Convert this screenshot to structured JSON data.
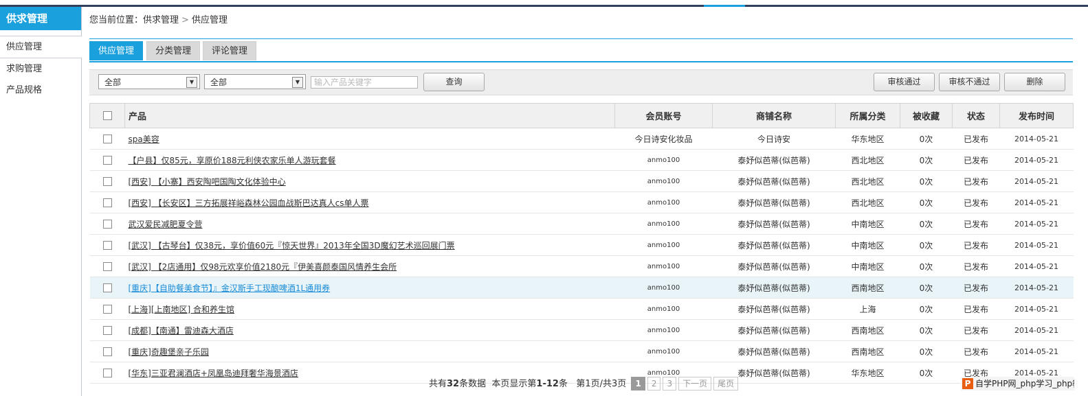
{
  "sidebar": {
    "title": "供求管理",
    "items": [
      "供应管理",
      "求购管理",
      "产品规格"
    ]
  },
  "breadcrumb": {
    "prefix": "您当前位置：",
    "level1": "供求管理",
    "separator": ">",
    "level2": "供应管理"
  },
  "tabs": [
    "供应管理",
    "分类管理",
    "评论管理"
  ],
  "filter": {
    "select1": "全部",
    "select2": "全部",
    "keyword_placeholder": "输入产品关键字",
    "query_button": "查询",
    "approve_button": "审核通过",
    "reject_button": "审核不通过",
    "delete_button": "删除"
  },
  "table": {
    "headers": [
      "产品",
      "会员账号",
      "商铺名称",
      "所属分类",
      "被收藏",
      "状态",
      "发布时间"
    ],
    "rows": [
      [
        "spa美容",
        "今日诗安化妆品",
        "今日诗安",
        "华东地区",
        "0次",
        "已发布",
        "2014-05-21"
      ],
      [
        "【户县】仅85元，享原价188元利侠农家乐单人游玩套餐",
        "anmo100",
        "泰妤似芭蒂(似芭蒂)",
        "西北地区",
        "0次",
        "已发布",
        "2014-05-21"
      ],
      [
        "[西安] 【小寨】西安陶吧国陶文化体验中心",
        "anmo100",
        "泰妤似芭蒂(似芭蒂)",
        "西北地区",
        "0次",
        "已发布",
        "2014-05-21"
      ],
      [
        "[西安] 【长安区】三方拓展祥峪森林公园血战斯巴达真人cs单人票",
        "anmo100",
        "泰妤似芭蒂(似芭蒂)",
        "西北地区",
        "0次",
        "已发布",
        "2014-05-21"
      ],
      [
        "武汉爱民减肥夏令营",
        "anmo100",
        "泰妤似芭蒂(似芭蒂)",
        "中南地区",
        "0次",
        "已发布",
        "2014-05-21"
      ],
      [
        "[武汉] 【古琴台】仅38元，享价值60元『惊天世界』2013年全国3D魔幻艺术巡回展门票",
        "anmo100",
        "泰妤似芭蒂(似芭蒂)",
        "中南地区",
        "0次",
        "已发布",
        "2014-05-21"
      ],
      [
        "[武汉] 【2店通用】仅98元欢享价值2180元『伊美喜颜泰国风情养生会所",
        "anmo100",
        "泰妤似芭蒂(似芭蒂)",
        "中南地区",
        "0次",
        "已发布",
        "2014-05-21"
      ],
      [
        "[重庆]【自助餐美食节】』金汉斯手工现酿啤酒1L通用券",
        "anmo100",
        "泰妤似芭蒂(似芭蒂)",
        "西南地区",
        "0次",
        "已发布",
        "2014-05-21"
      ],
      [
        "[上海][上南地区] 合和养生馆",
        "anmo100",
        "泰妤似芭蒂(似芭蒂)",
        "上海",
        "0次",
        "已发布",
        "2014-05-21"
      ],
      [
        "[成都]【南通】雷迪森大酒店",
        "anmo100",
        "泰妤似芭蒂(似芭蒂)",
        "西南地区",
        "0次",
        "已发布",
        "2014-05-21"
      ],
      [
        "[重庆]奇趣堡亲子乐园",
        "anmo100",
        "泰妤似芭蒂(似芭蒂)",
        "西南地区",
        "0次",
        "已发布",
        "2014-05-21"
      ],
      [
        "[华东]三亚君澜酒店+凤凰岛迪拜奢华海景酒店",
        "anmo100",
        "泰妤似芭蒂(似芭蒂)",
        "华东地区",
        "0次",
        "已发布",
        "2014-05-21"
      ]
    ]
  },
  "pagination": {
    "total_prefix": "共有",
    "total": "32",
    "total_suffix": "条数据",
    "range_prefix": "本页显示第",
    "range": "1-12",
    "range_suffix": "条",
    "page_info": "第1页/共3页",
    "pages": [
      "1",
      "2",
      "3"
    ],
    "next": "下一页",
    "last": "尾页"
  },
  "watermark": {
    "logo": "P",
    "text": "自学PHP网_php学习_php教程"
  },
  "colors": {
    "accent": "#1aa0dc",
    "topbar": "#2f3f5c",
    "highlight_row": "#e8f4f8",
    "link_highlight": "#1a8cd8"
  }
}
